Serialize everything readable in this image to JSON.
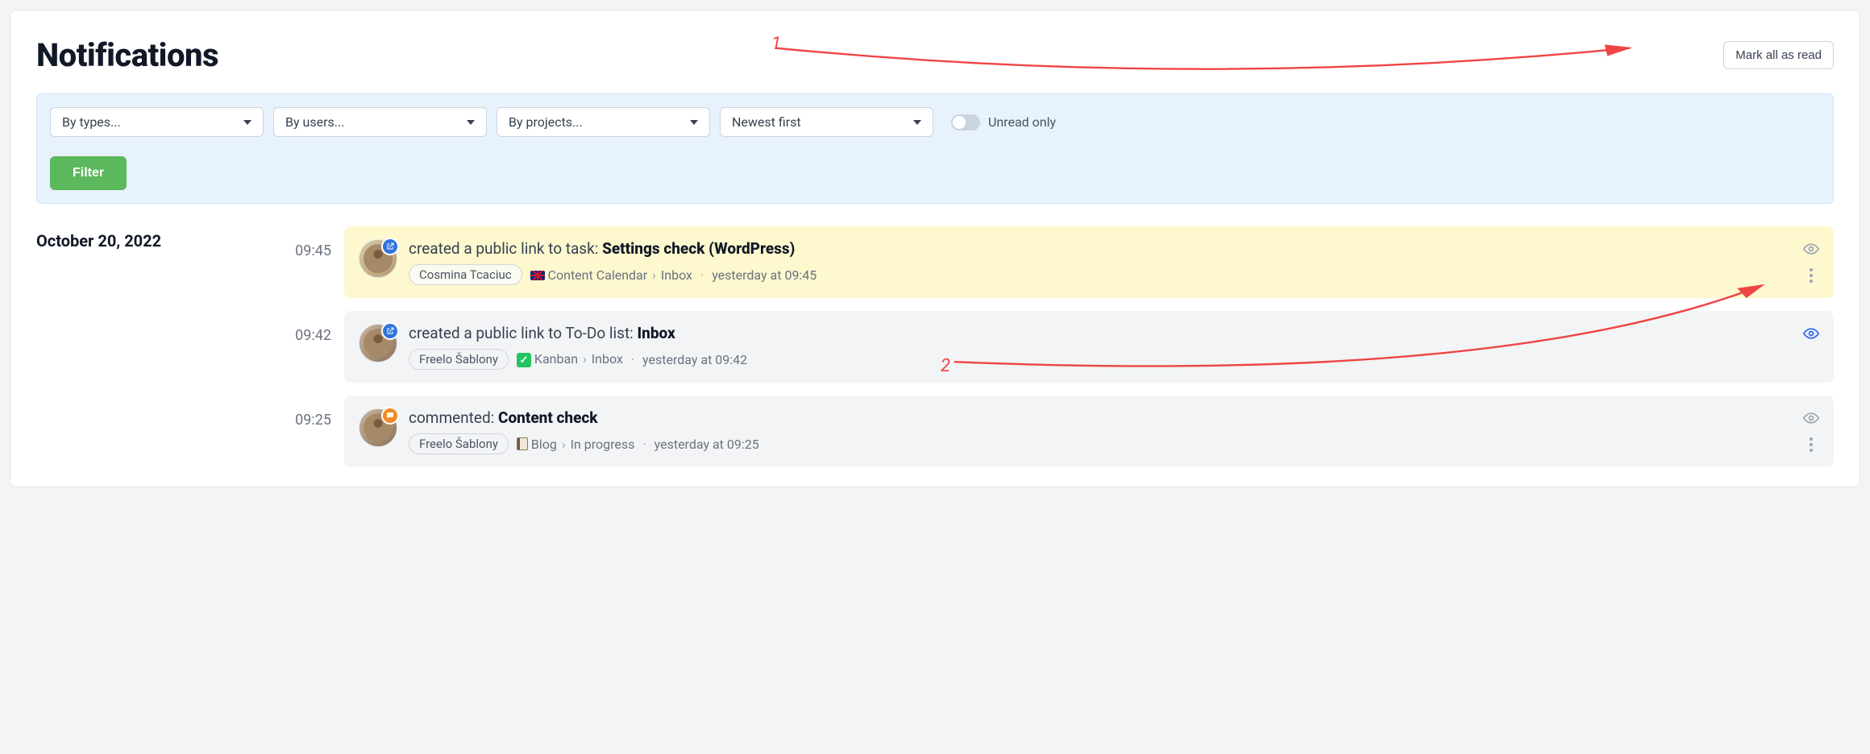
{
  "header": {
    "title": "Notifications",
    "mark_all_label": "Mark all as read"
  },
  "filters": {
    "by_types": "By types...",
    "by_users": "By users...",
    "by_projects": "By projects...",
    "sort": "Newest first",
    "unread_only_label": "Unread only",
    "filter_button": "Filter"
  },
  "date_group": "October 20, 2022",
  "annotations": {
    "one": "1",
    "two": "2"
  },
  "items": [
    {
      "time": "09:45",
      "unread": true,
      "badge": "link",
      "action_prefix": "created a public link to task: ",
      "subject": "Settings check (WordPress)",
      "author": "Cosmina Tcaciuc",
      "project_icon": "uk",
      "project": "Content Calendar",
      "sublist": "Inbox",
      "timestamp": "yesterday at 09:45",
      "eye": "gray"
    },
    {
      "time": "09:42",
      "unread": false,
      "badge": "link",
      "action_prefix": "created a public link to To-Do list: ",
      "subject": "Inbox",
      "author": "Freelo Šablony",
      "project_icon": "check",
      "project": "Kanban",
      "sublist": "Inbox",
      "timestamp": "yesterday at 09:42",
      "eye": "blue"
    },
    {
      "time": "09:25",
      "unread": false,
      "badge": "comment",
      "action_prefix": "commented: ",
      "subject": "Content check",
      "author": "Freelo Šablony",
      "project_icon": "book",
      "project": "Blog",
      "sublist": "In progress",
      "timestamp": "yesterday at 09:25",
      "eye": "gray"
    }
  ]
}
